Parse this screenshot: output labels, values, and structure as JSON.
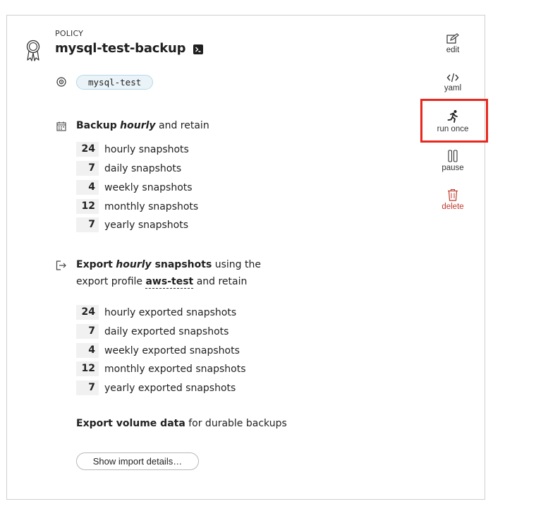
{
  "header": {
    "kicker": "POLICY",
    "title": "mysql-test-backup",
    "target_tag": "mysql-test"
  },
  "backup": {
    "prefix": "Backup",
    "frequency": "hourly",
    "suffix": "and retain",
    "retention": [
      {
        "count": "24",
        "label": "hourly snapshots"
      },
      {
        "count": "7",
        "label": "daily snapshots"
      },
      {
        "count": "4",
        "label": "weekly snapshots"
      },
      {
        "count": "12",
        "label": "monthly snapshots"
      },
      {
        "count": "7",
        "label": "yearly snapshots"
      }
    ]
  },
  "export": {
    "prefix": "Export",
    "frequency": "hourly",
    "snapshots_word": "snapshots",
    "using": "using the",
    "profile_prefix": "export profile",
    "profile": "aws-test",
    "suffix": "and retain",
    "retention": [
      {
        "count": "24",
        "label": "hourly exported snapshots"
      },
      {
        "count": "7",
        "label": "daily exported snapshots"
      },
      {
        "count": "4",
        "label": "weekly exported snapshots"
      },
      {
        "count": "12",
        "label": "monthly exported snapshots"
      },
      {
        "count": "7",
        "label": "yearly exported snapshots"
      }
    ]
  },
  "volume": {
    "bold": "Export volume data",
    "rest": "for durable backups"
  },
  "import_button": "Show import details…",
  "actions": {
    "edit": "edit",
    "yaml": "yaml",
    "run_once": "run once",
    "pause": "pause",
    "delete": "delete"
  },
  "colors": {
    "highlight": "#e8271f",
    "danger": "#c0392b",
    "tag_bg": "#eaf3f8"
  }
}
